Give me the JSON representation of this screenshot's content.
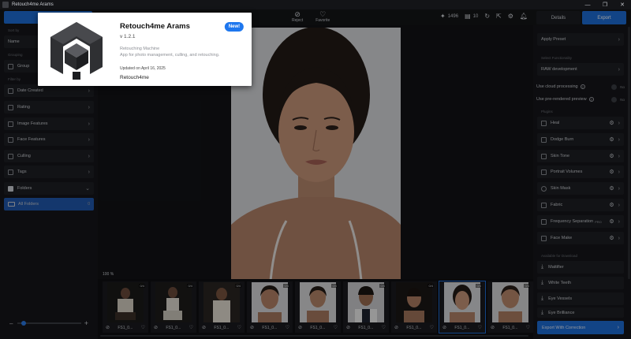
{
  "window": {
    "title": "Retouch4me Arams",
    "controls": [
      "—",
      "❐",
      "✕"
    ]
  },
  "toolbar": {
    "reject_label": "Reject",
    "favorite_label": "Favorite",
    "credits": "1496",
    "photos_count": "10",
    "tabs": [
      {
        "label": "Details"
      },
      {
        "label": "Export"
      }
    ]
  },
  "left_panel": {
    "sort_label": "Sort by",
    "sort_value": "Name",
    "grouping_label": "Grouping",
    "group_value": "Group",
    "filter_label": "Filter by",
    "filters": [
      {
        "label": "Date Created"
      },
      {
        "label": "Rating"
      },
      {
        "label": "Image Features"
      },
      {
        "label": "Face Features"
      },
      {
        "label": "Culling"
      },
      {
        "label": "Tags"
      }
    ],
    "folders_label": "Folders",
    "all_folders_label": "All Folders",
    "all_folders_count": "0"
  },
  "viewer": {
    "zoom": "100 %"
  },
  "filmstrip": {
    "items": [
      {
        "name": "FS1_0...",
        "badge": "0/4"
      },
      {
        "name": "FS1_0...",
        "badge": "0/4"
      },
      {
        "name": "FS1_0...",
        "badge": "0/4"
      },
      {
        "name": "FS1_0...",
        "badge": "0/4"
      },
      {
        "name": "FS1_0...",
        "badge": "0/4"
      },
      {
        "name": "FS1_0...",
        "badge": "0/4"
      },
      {
        "name": "FS1_0...",
        "badge": "0/4"
      },
      {
        "name": "FS1_0...",
        "badge": "0/4"
      },
      {
        "name": "FS1_0...",
        "badge": "0/4"
      }
    ]
  },
  "right_panel": {
    "apply_preset": "Apply Preset",
    "select_functionality_label": "Select Functionality",
    "raw_dev": "RAW development",
    "cloud_processing": "Use cloud processing",
    "cloud_state": "No",
    "prerendered": "Use pre-rendered preview",
    "prerendered_state": "No",
    "plugins_label": "Plugins",
    "plugins": [
      {
        "label": "Heal"
      },
      {
        "label": "Dodge Burn"
      },
      {
        "label": "Skin Tone"
      },
      {
        "label": "Portrait Volumes"
      },
      {
        "label": "Skin Mask"
      },
      {
        "label": "Fabric"
      },
      {
        "label": "Frequency Separation",
        "tag": "PRO"
      },
      {
        "label": "Face Make"
      }
    ],
    "downloads_label": "Available for Download",
    "downloads": [
      {
        "label": "Mattifier"
      },
      {
        "label": "White Teeth"
      },
      {
        "label": "Eye Vessels"
      },
      {
        "label": "Eye Brilliance"
      }
    ],
    "export_label": "Export With Correction"
  },
  "about": {
    "name": "Retouch4me Arams",
    "badge": "New!",
    "version": "v 1.2.1",
    "desc1": "Retouching Machine",
    "desc2": "App for photo management, culling, and retouching.",
    "updated": "Updated on April 16, 2025",
    "vendor": "Retouch4me"
  },
  "colors": {
    "accent": "#1e6fd9",
    "panel": "#15161a",
    "background": "#111215"
  }
}
